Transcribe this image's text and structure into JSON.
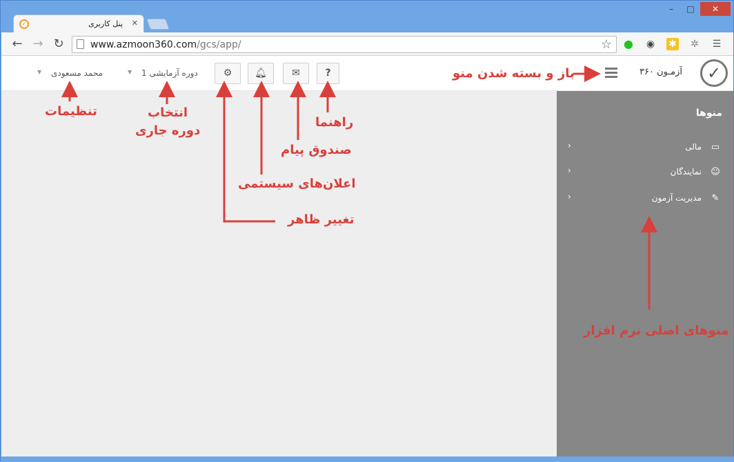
{
  "browser": {
    "tab_title": "پنل کاربری",
    "url_host": "www.azmoon360.com",
    "url_path": "/gcs/app/"
  },
  "header": {
    "brand": "آزمـون ۳۶۰",
    "user_name": "محمد مسعودی",
    "period": "دوره آزمایشی 1",
    "help_label": "?"
  },
  "sidebar": {
    "title": "منوها",
    "items": [
      {
        "label": "مالی",
        "icon": "credit-card-icon"
      },
      {
        "label": "نمایندگان",
        "icon": "users-icon"
      },
      {
        "label": "مدیریت آزمون",
        "icon": "edit-icon"
      }
    ]
  },
  "annotations": {
    "menu_toggle": "باز و بسته شدن منو",
    "help": "راهنما",
    "inbox": "صندوق پیام",
    "notifications": "اعلان‌های سیستمی",
    "theme": "تغییر ظاهر",
    "period_select_line1": "انتخاب",
    "period_select_line2": "دوره جاری",
    "settings": "تنظیمات",
    "main_menus": "منوهای اصلی نرم افزار"
  },
  "colors": {
    "annotation": "#d9403a",
    "sidebar": "#878787"
  }
}
